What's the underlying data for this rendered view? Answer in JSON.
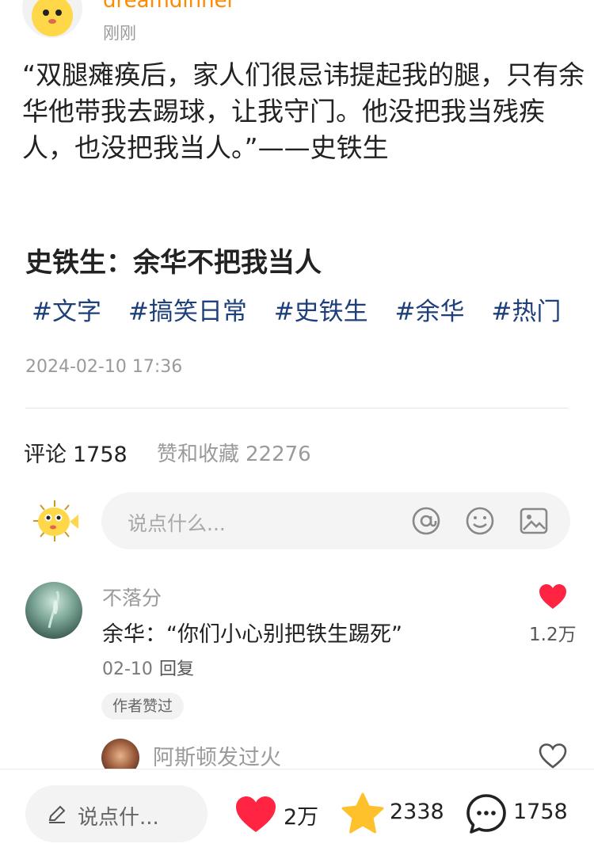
{
  "post": {
    "username": "dreamdinner",
    "posted_time": "刚刚",
    "body": "“双腿瘫痪后，家人们很忌讳提起我的腿，只有余华他带我去踢球，让我守门。他没把我当残疾人，也没把我当人。”——史铁生",
    "title": "史铁生：余华不把我当人",
    "tags": [
      "#文字",
      "#搞笑日常",
      "#史铁生",
      "#余华",
      "#热门",
      "#"
    ],
    "date": "2024-02-10 17:36"
  },
  "stats": {
    "comments_label": "评论",
    "comments_count": "1758",
    "likes_collects_label": "赞和收藏",
    "likes_collects_count": "22276"
  },
  "comment_input": {
    "placeholder": "说点什么..."
  },
  "comments": [
    {
      "username": "不落分",
      "text": "余华：“你们小心别把铁生踢死”",
      "date": "02-10",
      "reply_label": "回复",
      "badge": "作者赞过",
      "likes": "1.2万",
      "liked": true
    },
    {
      "username": "阿斯顿发过火",
      "liked": false
    }
  ],
  "bottom_bar": {
    "input_placeholder": "说点什...",
    "likes": "2万",
    "collects": "2338",
    "comments": "1758"
  },
  "colors": {
    "accent_red": "#ff2442",
    "tag_blue": "#1d3f7a",
    "star_yellow": "#ffc12b",
    "username_orange": "#ff8a00"
  }
}
